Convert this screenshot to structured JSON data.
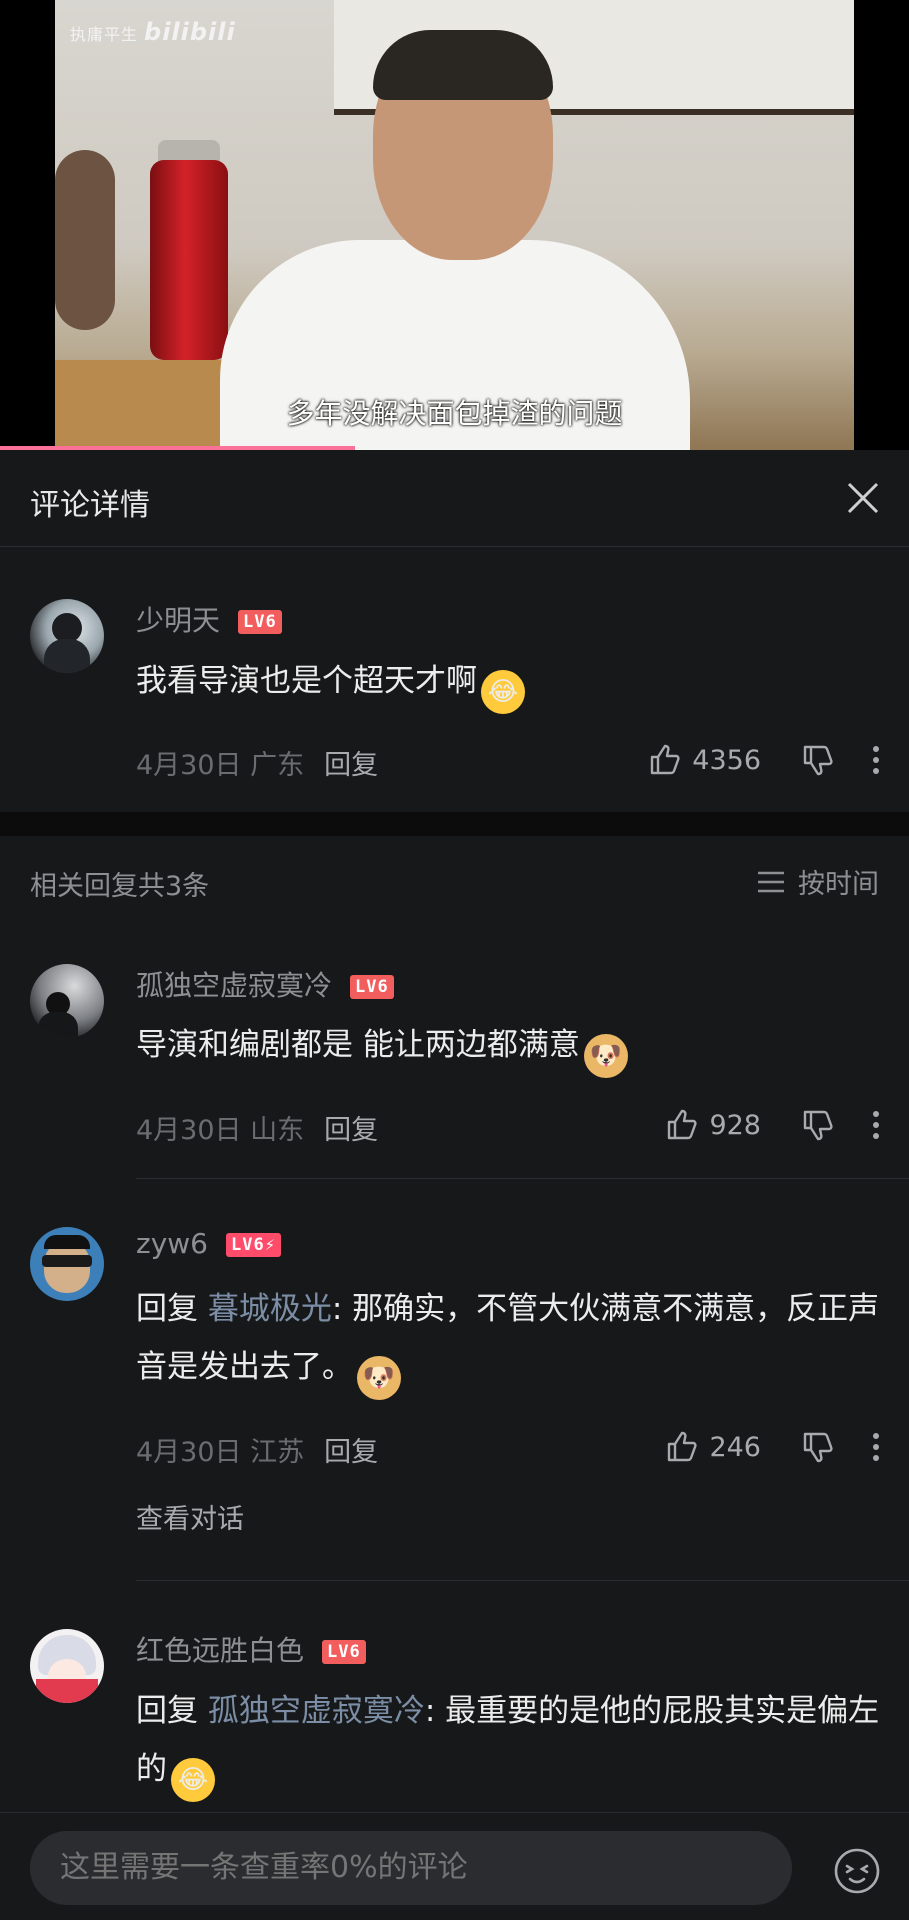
{
  "video": {
    "watermark_text": "执庸平生",
    "watermark_logo": "bilibili",
    "subtitle": "多年没解决面包掉渣的问题",
    "progress": 0.39
  },
  "header": {
    "title": "评论详情",
    "close_icon": "close-icon"
  },
  "main_comment": {
    "username": "少明天",
    "level": "LV6",
    "text": "我看导演也是个超天才啊",
    "emoji": "laugh-cry",
    "date": "4月30日",
    "location": "广东",
    "reply_label": "回复",
    "likes": "4356"
  },
  "related": {
    "count_text": "相关回复共3条",
    "sort_label": "按时间"
  },
  "replies": [
    {
      "username": "孤独空虚寂寞冷",
      "level": "LV6",
      "text": "导演和编剧都是 能让两边都满意",
      "emoji": "doge",
      "date": "4月30日",
      "location": "山东",
      "reply_label": "回复",
      "likes": "928"
    },
    {
      "username": "zyw6",
      "level": "LV6⚡",
      "prefix": "回复",
      "mention": "暮城极光",
      "text": ": 那确实，不管大伙满意不满意，反正声音是发出去了。",
      "emoji": "doge",
      "date": "4月30日",
      "location": "江苏",
      "reply_label": "回复",
      "likes": "246",
      "view_conversation": "查看对话"
    },
    {
      "username": "红色远胜白色",
      "level": "LV6",
      "prefix": "回复",
      "mention": "孤独空虚寂寞冷",
      "text": ": 最重要的是他的屁股其实是偏左的",
      "emoji": "laugh-cry"
    }
  ],
  "bottom": {
    "placeholder": "这里需要一条查重率0%的评论",
    "emoji_icon": "emoji-icon"
  },
  "colors": {
    "accent": "#fb7299",
    "level_badge": "#f25d5d",
    "mention": "#7b8ea6",
    "background": "#17181a"
  }
}
